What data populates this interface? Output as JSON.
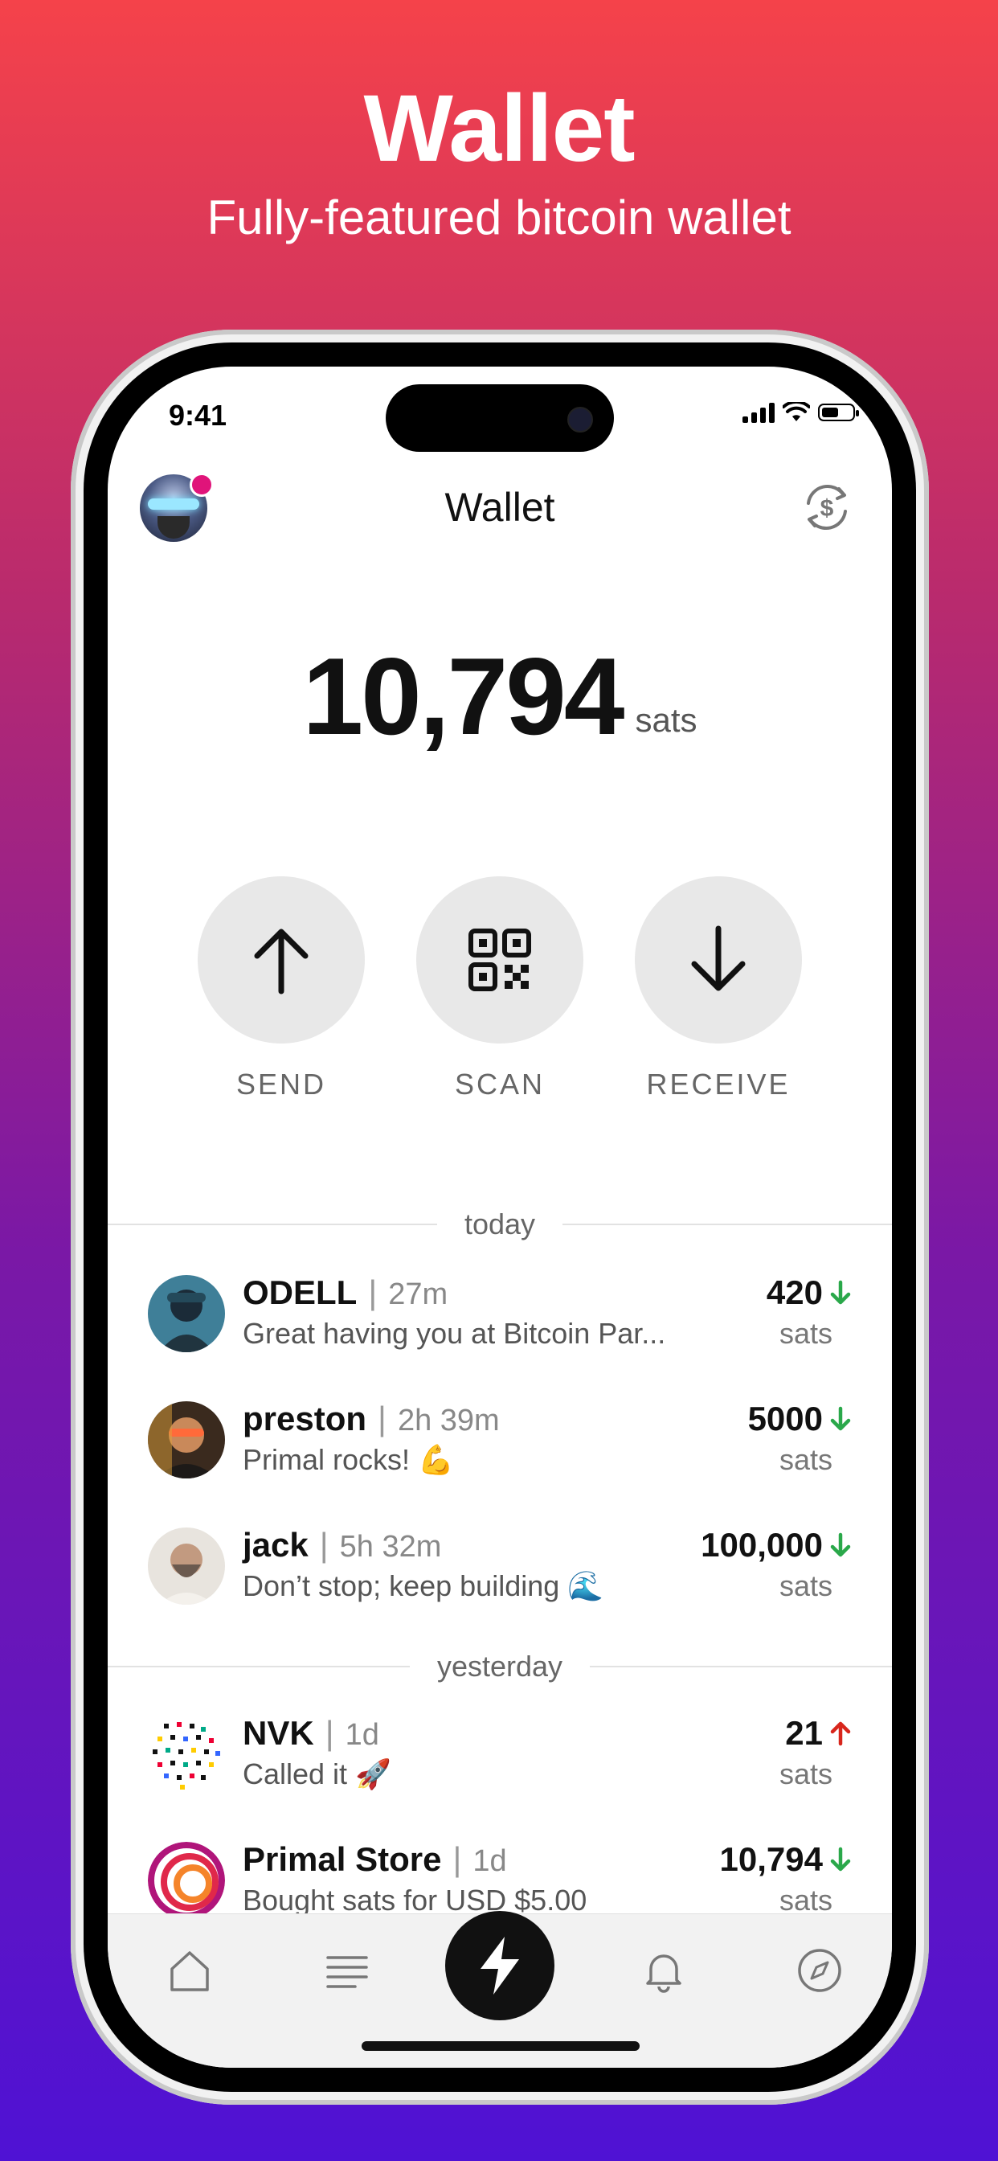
{
  "hero": {
    "title": "Wallet",
    "subtitle": "Fully-featured bitcoin wallet"
  },
  "status_bar": {
    "time": "9:41"
  },
  "header": {
    "title": "Wallet",
    "currency_icon": "dollar-cycle-icon"
  },
  "balance": {
    "amount": "10,794",
    "unit": "sats"
  },
  "actions": {
    "send_label": "SEND",
    "scan_label": "SCAN",
    "receive_label": "RECEIVE"
  },
  "sections": {
    "today": "today",
    "yesterday": "yesterday"
  },
  "transactions": [
    {
      "name": "ODELL",
      "time": "27m",
      "message": "Great having you at Bitcoin Par...",
      "amount": "420",
      "unit": "sats",
      "direction": "in"
    },
    {
      "name": "preston",
      "time": "2h 39m",
      "message": "Primal rocks! 💪",
      "amount": "5000",
      "unit": "sats",
      "direction": "in"
    },
    {
      "name": "jack",
      "time": "5h 32m",
      "message": "Don’t stop; keep building 🌊",
      "amount": "100,000",
      "unit": "sats",
      "direction": "in"
    },
    {
      "name": "NVK",
      "time": "1d",
      "message": "Called it 🚀",
      "amount": "21",
      "unit": "sats",
      "direction": "out"
    },
    {
      "name": "Primal Store",
      "time": "1d",
      "message": "Bought sats for USD $5.00",
      "amount": "10,794",
      "unit": "sats",
      "direction": "in"
    }
  ],
  "colors": {
    "incoming": "#2aa84a",
    "outgoing": "#d8261c",
    "notify_dot": "#e0147a"
  },
  "nav": {
    "items": [
      "home-icon",
      "feed-icon",
      "lightning-icon",
      "bell-icon",
      "compass-icon"
    ]
  }
}
